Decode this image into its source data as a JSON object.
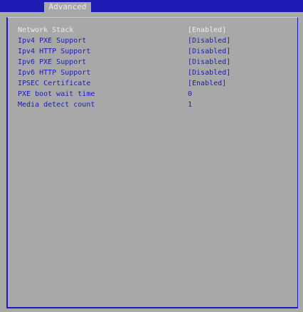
{
  "tabs": {
    "active_label": "Advanced"
  },
  "colors": {
    "background": "#a8a8a8",
    "accent_blue": "#1c1cb4",
    "selected_text": "#ececf6"
  },
  "settings": [
    {
      "label": "Network Stack",
      "value": "[Enabled]",
      "selected": true
    },
    {
      "label": "Ipv4 PXE Support",
      "value": "[Disabled]",
      "selected": false
    },
    {
      "label": "Ipv4 HTTP Support",
      "value": "[Disabled]",
      "selected": false
    },
    {
      "label": "Ipv6 PXE Support",
      "value": "[Disabled]",
      "selected": false
    },
    {
      "label": "Ipv6 HTTP Support",
      "value": "[Disabled]",
      "selected": false
    },
    {
      "label": "IPSEC Certificate",
      "value": "[Enabled]",
      "selected": false
    },
    {
      "label": "PXE boot wait time",
      "value": "0",
      "selected": false
    },
    {
      "label": "Media detect count",
      "value": "1",
      "selected": false
    }
  ]
}
